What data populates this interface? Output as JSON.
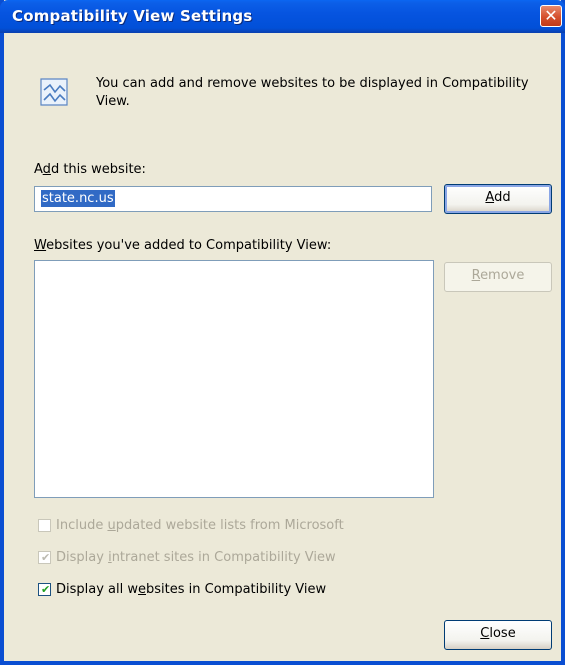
{
  "window": {
    "title": "Compatibility View Settings",
    "close_glyph": "✕"
  },
  "info": {
    "text": "You can add and remove websites to be displayed in Compatibility View."
  },
  "add_section": {
    "label_pre": "A",
    "label_u": "d",
    "label_post": "d this website:",
    "value": "state.nc.us",
    "add_button_u": "A",
    "add_button_post": "dd"
  },
  "list_section": {
    "label_u": "W",
    "label_post": "ebsites you've added to Compatibility View:",
    "remove_button_u": "R",
    "remove_button_post": "emove",
    "items": []
  },
  "options": [
    {
      "pre": "Include ",
      "u": "u",
      "post": "pdated website lists from Microsoft",
      "checked": false,
      "enabled": false
    },
    {
      "pre": "Display ",
      "u": "i",
      "post": "ntranet sites in Compatibility View",
      "checked": true,
      "enabled": false
    },
    {
      "pre": "Display all w",
      "u": "e",
      "post": "bsites in Compatibility View",
      "checked": true,
      "enabled": true
    }
  ],
  "footer": {
    "close_u": "C",
    "close_post": "lose"
  },
  "icon_names": {
    "info": "compatibility-view-page-icon",
    "close": "close-x-icon"
  }
}
